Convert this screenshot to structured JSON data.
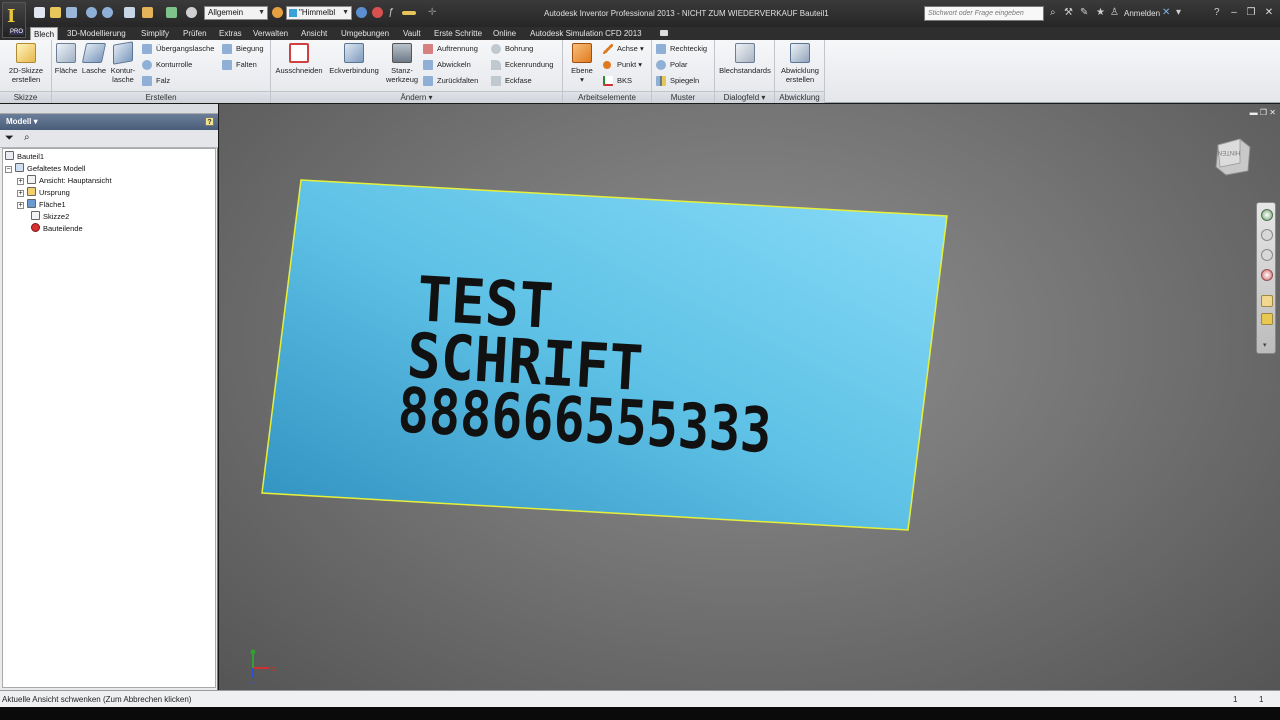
{
  "titlebar": {
    "style_select": "Allgemein",
    "appearance_select": "\"Himmelbl",
    "window_title": "Autodesk Inventor Professional 2013 - NICHT ZUM WIEDERVERKAUF    Bauteil1",
    "search_placeholder": "Stichwort oder Frage eingeben",
    "signin_label": "Anmelden",
    "app_logo": "I",
    "app_badge": "PRO"
  },
  "tabs": [
    "Blech",
    "3D-Modellierung",
    "Simplify",
    "Prüfen",
    "Extras",
    "Verwalten",
    "Ansicht",
    "Umgebungen",
    "Vault",
    "Erste Schritte",
    "Online",
    "Autodesk Simulation CFD 2013"
  ],
  "ribbon": {
    "skizze": {
      "title": "Skizze",
      "create_sketch_l1": "2D-Skizze",
      "create_sketch_l2": "erstellen"
    },
    "erstellen": {
      "title": "Erstellen",
      "flaeche": "Fläche",
      "lasche": "Lasche",
      "kontur_l1": "Kontur-",
      "kontur_l2": "lasche",
      "uebergangslasche": "Übergangslasche",
      "konturrolle": "Konturrolle",
      "falz": "Falz",
      "biegung": "Biegung",
      "falten": "Falten"
    },
    "aendern": {
      "title": "Ändern",
      "ausschneiden": "Ausschneiden",
      "eckverbindung": "Eckverbindung",
      "stanz_l1": "Stanz-",
      "stanz_l2": "werkzeug",
      "auftrennung": "Auftrennung",
      "abwickeln": "Abwickeln",
      "zurueckfalten": "Zurückfalten",
      "bohrung": "Bohrung",
      "eckenrundung": "Eckenrundung",
      "eckfase": "Eckfase"
    },
    "arbeitselemente": {
      "title": "Arbeitselemente",
      "ebene": "Ebene",
      "achse": "Achse",
      "punkt": "Punkt",
      "bks": "BKS"
    },
    "muster": {
      "title": "Muster",
      "rechteckig": "Rechteckig",
      "polar": "Polar",
      "spiegeln": "Spiegeln"
    },
    "dialogfeld": {
      "title": "Dialogfeld",
      "blechstandards": "Blechstandards"
    },
    "abwicklung": {
      "title": "Abwicklung",
      "create_l1": "Abwicklung",
      "create_l2": "erstellen"
    }
  },
  "browser": {
    "header": "Modell",
    "help": "?",
    "tree": [
      {
        "label": "Bauteil1",
        "icon": "part-icon"
      },
      {
        "label": "Gefaltetes Modell",
        "icon": "folded-model-icon"
      },
      {
        "label": "Ansicht: Hauptansicht",
        "icon": "view-icon"
      },
      {
        "label": "Ursprung",
        "icon": "folder-icon"
      },
      {
        "label": "Fläche1",
        "icon": "face-icon"
      },
      {
        "label": "Skizze2",
        "icon": "sketch-icon"
      },
      {
        "label": "Bauteilende",
        "icon": "end-of-part-icon"
      }
    ]
  },
  "viewport": {
    "plate_text": [
      "TEST",
      "SCHRIFT",
      "888666555333"
    ],
    "viewcube_label": "HINTEN",
    "plate_color": "#5fc2e6",
    "edge_color": "#e6f03a"
  },
  "statusbar": {
    "text": "Aktuelle Ansicht schwenken (Zum Abbrechen klicken)",
    "n1": "1",
    "n2": "1"
  }
}
